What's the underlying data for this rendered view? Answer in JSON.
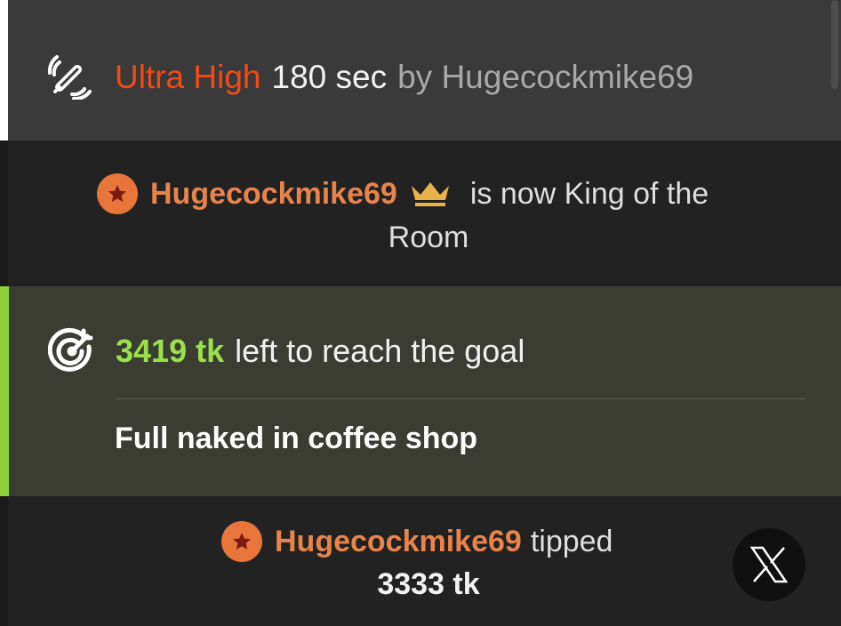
{
  "vibe": {
    "level": "Ultra High",
    "duration": "180 sec",
    "by_prefix": "by",
    "username": "Hugecockmike69",
    "icon": "vibration-icon",
    "level_color": "#f24a13"
  },
  "king": {
    "username": "Hugecockmike69",
    "text": "is now King of the",
    "text_line2": "Room",
    "badge_icon": "star-badge-icon",
    "crown_icon": "crown-icon"
  },
  "goal": {
    "tokens_left": "3419 tk",
    "text": "left to reach the goal",
    "description": "Full naked in coffee shop",
    "icon": "target-icon",
    "accent_color": "#8ed13a"
  },
  "tip": {
    "username": "Hugecockmike69",
    "action": "tipped",
    "amount": "3333 tk",
    "badge_icon": "star-badge-icon"
  },
  "overlay": {
    "button_icon": "x-logo-icon"
  }
}
